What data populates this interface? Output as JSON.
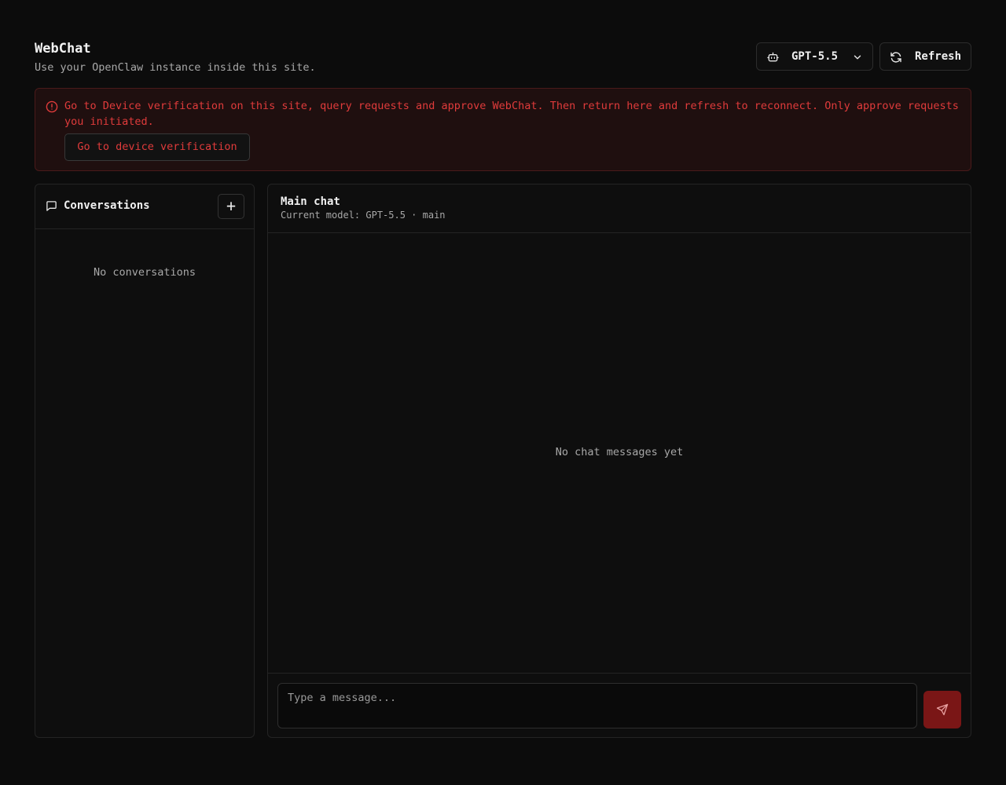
{
  "header": {
    "title": "WebChat",
    "subtitle": "Use your OpenClaw instance inside this site.",
    "model_select": {
      "value": "GPT-5.5",
      "icon": "bot-icon"
    },
    "refresh_label": "Refresh"
  },
  "alert": {
    "message": "Go to Device verification on this site, query requests and approve WebChat. Then return here and refresh to reconnect. Only approve requests you initiated.",
    "button_label": "Go to device verification",
    "color": "#e03b3b"
  },
  "sidebar": {
    "title": "Conversations",
    "add_label": "+",
    "empty_text": "No conversations"
  },
  "chat": {
    "title": "Main chat",
    "subtitle": "Current model: GPT-5.5 · main",
    "empty_text": "No chat messages yet",
    "input_placeholder": "Type a message...",
    "send_color": "#7a1616"
  }
}
